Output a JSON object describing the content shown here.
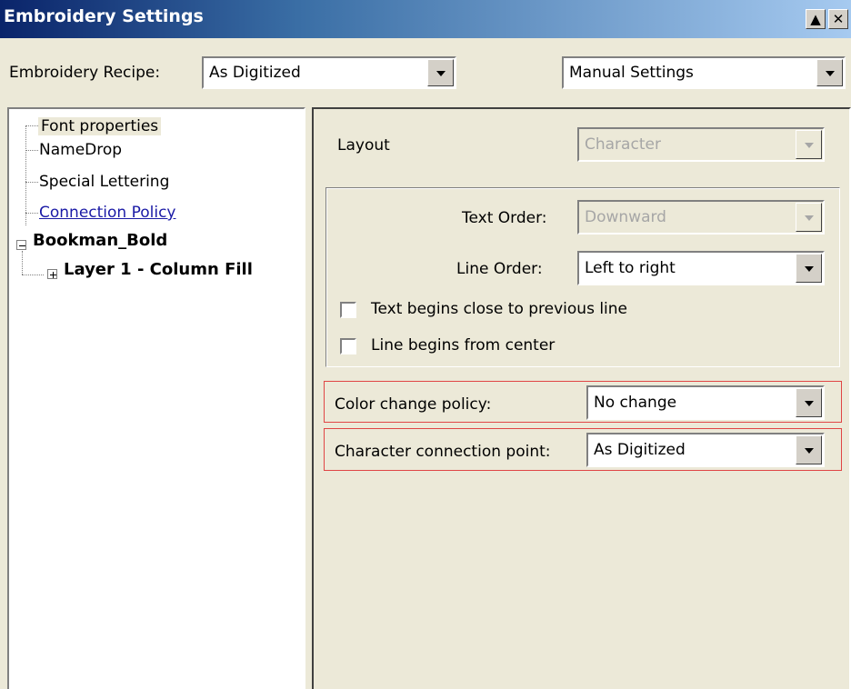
{
  "window": {
    "title": "Embroidery Settings",
    "minimize_glyph": "▲",
    "close_glyph": "✕"
  },
  "toolbar": {
    "recipe_label": "Embroidery Recipe:",
    "recipe_value": "As Digitized",
    "mode_value": "Manual Settings"
  },
  "tree": {
    "items": [
      {
        "label": "Font properties"
      },
      {
        "label": "NameDrop"
      },
      {
        "label": "Special Lettering"
      },
      {
        "label": "Connection Policy"
      },
      {
        "label": "Bookman_Bold"
      },
      {
        "label": "Layer 1 - Column Fill"
      }
    ]
  },
  "panel": {
    "layout_label": "Layout",
    "layout_value": "Character",
    "text_order_label": "Text Order:",
    "text_order_value": "Downward",
    "line_order_label": "Line Order:",
    "line_order_value": "Left to right",
    "checkbox1_label": "Text begins close to previous line",
    "checkbox1_checked": false,
    "checkbox2_label": "Line begins from center",
    "checkbox2_checked": false,
    "color_policy_label": "Color change policy:",
    "color_policy_value": "No change",
    "connection_point_label": "Character connection point:",
    "connection_point_value": "As Digitized"
  },
  "colors": {
    "highlight_border": "#e04545",
    "link_color": "#1a1aa6",
    "titlebar_start": "#0a246a",
    "titlebar_end": "#a6caf0"
  }
}
